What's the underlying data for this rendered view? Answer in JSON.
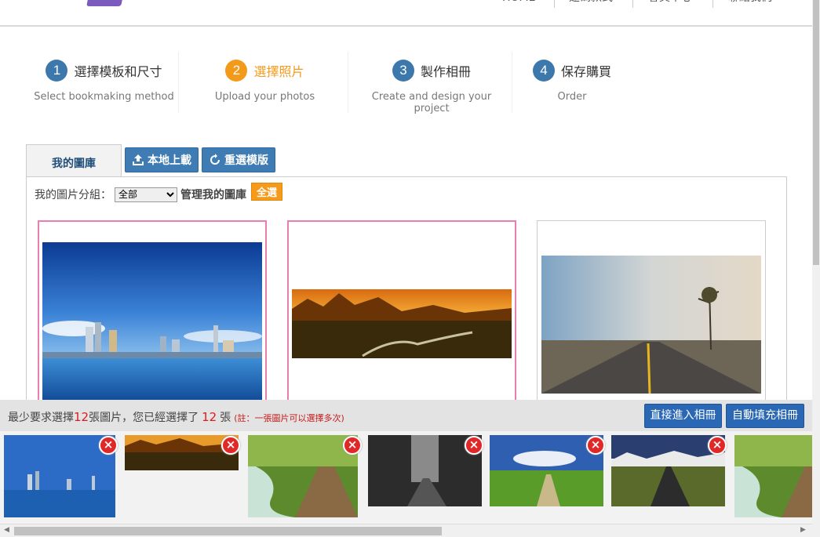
{
  "top_nav": {
    "items": [
      "HOME",
      "建碼款式",
      "會員中心",
      "聯絡我們"
    ]
  },
  "steps": [
    {
      "num": "1",
      "title": "選擇模板和尺寸",
      "sub": "Select bookmaking method",
      "color": "#3d78ad"
    },
    {
      "num": "2",
      "title": "選擇照片",
      "sub": "Upload your photos",
      "color": "#f49a1b"
    },
    {
      "num": "3",
      "title": "製作相冊",
      "sub": "Create and design your project",
      "color": "#3d78ad"
    },
    {
      "num": "4",
      "title": "保存購買",
      "sub": "Order",
      "color": "#3d78ad"
    }
  ],
  "tabs": {
    "gallery": "我的圖庫",
    "local_upload": "本地上載",
    "reselect": "重選模版"
  },
  "gallery": {
    "group_label": "我的圖片分組：",
    "group_selected": "全部",
    "manage_label": "管理我的圖庫",
    "select_all": "全選",
    "photos": [
      {
        "name": "city-skyline-photo",
        "selected": true
      },
      {
        "name": "mountain-sunset-photo",
        "selected": true
      },
      {
        "name": "foggy-road-photo",
        "selected": false
      }
    ]
  },
  "requirement": {
    "prefix": "最少要求選擇",
    "min_count": "12",
    "middle": "張圖片，您已經選擇了",
    "selected_count": "12",
    "suffix": "張",
    "note": "(註：一張圖片可以選擇多次)"
  },
  "actions": {
    "enter_album": "直接進入相冊",
    "autofill": "自動填充相冊"
  },
  "selected_thumbs": [
    "city-skyline",
    "mountain-sunset",
    "forest-boardwalk",
    "dark-forest-road",
    "green-field-path",
    "mountain-road",
    "forest-boardwalk"
  ],
  "colors": {
    "accent_blue": "#3e7cb3",
    "accent_orange": "#f49a1b",
    "selected_border": "#e87fb0",
    "delete_red": "#e02828"
  }
}
